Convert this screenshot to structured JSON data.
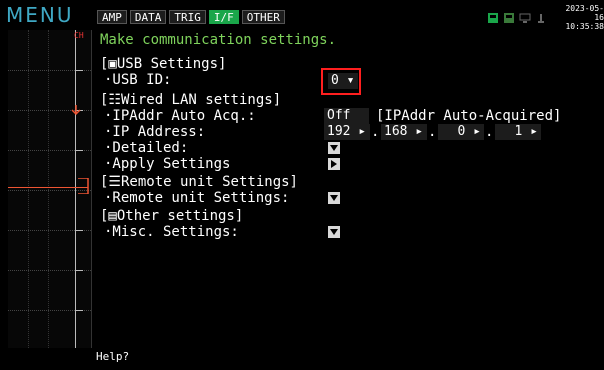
{
  "topbar": {
    "menu_label": "MENU",
    "tabs": [
      {
        "label": "AMP",
        "active": false
      },
      {
        "label": "DATA",
        "active": false
      },
      {
        "label": "TRIG",
        "active": false
      },
      {
        "label": "I/F",
        "active": true
      },
      {
        "label": "OTHER",
        "active": false
      }
    ],
    "date": "2023-05-16",
    "time": "10:35:38"
  },
  "graph": {
    "channel_label": "CH"
  },
  "settings": {
    "heading": "Make communication settings.",
    "usb_section": "[▣USB Settings]",
    "usb_id_label": "·USB ID:",
    "usb_id_value": "0 ▾",
    "lan_section": "[☷Wired LAN settings]",
    "ipaddr_auto_label": "·IPAddr Auto Acq.:",
    "ipaddr_auto_value": "Off ▾",
    "ipaddr_auto_note": "[IPAddr Auto-Acquired]",
    "ip_address_label": "·IP Address:",
    "ip_octets": [
      "192 ▸",
      "168 ▸",
      "0 ▸",
      "1 ▸"
    ],
    "ip_sep": ".",
    "detailed_label": "·Detailed:",
    "apply_label": "·Apply Settings",
    "remote_section": "[☰Remote unit Settings]",
    "remote_label": "·Remote unit Settings:",
    "other_section": "[▤Other settings]",
    "misc_label": "·Misc. Settings:"
  },
  "help": {
    "text": "Help?"
  },
  "colors": {
    "menu": "#3fa8c4",
    "active_tab": "#1aa64a",
    "heading": "#7fd35c",
    "highlight": "#ff1f1f"
  }
}
